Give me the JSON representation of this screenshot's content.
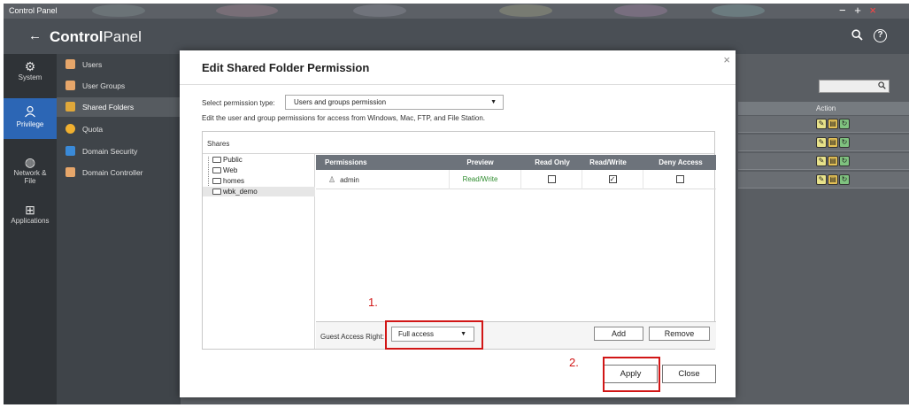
{
  "window": {
    "title": "Control Panel",
    "controls": [
      "−",
      "+",
      "×"
    ]
  },
  "appbar": {
    "back": "←",
    "app_bold": "Control",
    "app_thin": "Panel",
    "search_icon": "search-icon",
    "help": "?"
  },
  "leftnav": [
    {
      "label": "System",
      "icon": "gear-icon"
    },
    {
      "label": "Privilege",
      "icon": "user-icon"
    },
    {
      "label": "Network & File",
      "icon": "globe-icon"
    },
    {
      "label": "Applications",
      "icon": "grid-icon"
    }
  ],
  "subnav": [
    {
      "label": "Users",
      "color": "#e6a66a"
    },
    {
      "label": "User Groups",
      "color": "#e6a66a"
    },
    {
      "label": "Shared Folders",
      "color": "#e0a83a"
    },
    {
      "label": "Quota",
      "color": "#f0b030"
    },
    {
      "label": "Domain Security",
      "color": "#3a8ad8"
    },
    {
      "label": "Domain Controller",
      "color": "#e6a66a"
    }
  ],
  "background": {
    "search_icon": "search-icon",
    "action_header": "Action"
  },
  "dialog": {
    "title": "Edit Shared Folder Permission",
    "close": "×",
    "ptype_label": "Select permission type:",
    "ptype_value": "Users and groups permission",
    "ptype_desc": "Edit the user and group permissions for access from Windows, Mac, FTP, and File Station.",
    "shares_label": "Shares",
    "tree": [
      "Public",
      "Web",
      "homes",
      "wbk_demo"
    ],
    "columns": [
      "Permissions",
      "Preview",
      "Read Only",
      "Read/Write",
      "Deny Access"
    ],
    "rows": [
      {
        "user": "admin",
        "preview": "Read/Write",
        "read_only": false,
        "read_write": true,
        "deny": false
      }
    ],
    "guest_label": "Guest Access Right:",
    "guest_value": "Full access",
    "add": "Add",
    "remove": "Remove",
    "apply": "Apply",
    "close_btn": "Close"
  },
  "annotations": {
    "n1": "1.",
    "n2": "2.",
    "color": "#d11616"
  },
  "colors": {
    "nav_active": "#2c66b5",
    "preview_green": "#2f8d2f",
    "header_gray": "#6d737b"
  }
}
